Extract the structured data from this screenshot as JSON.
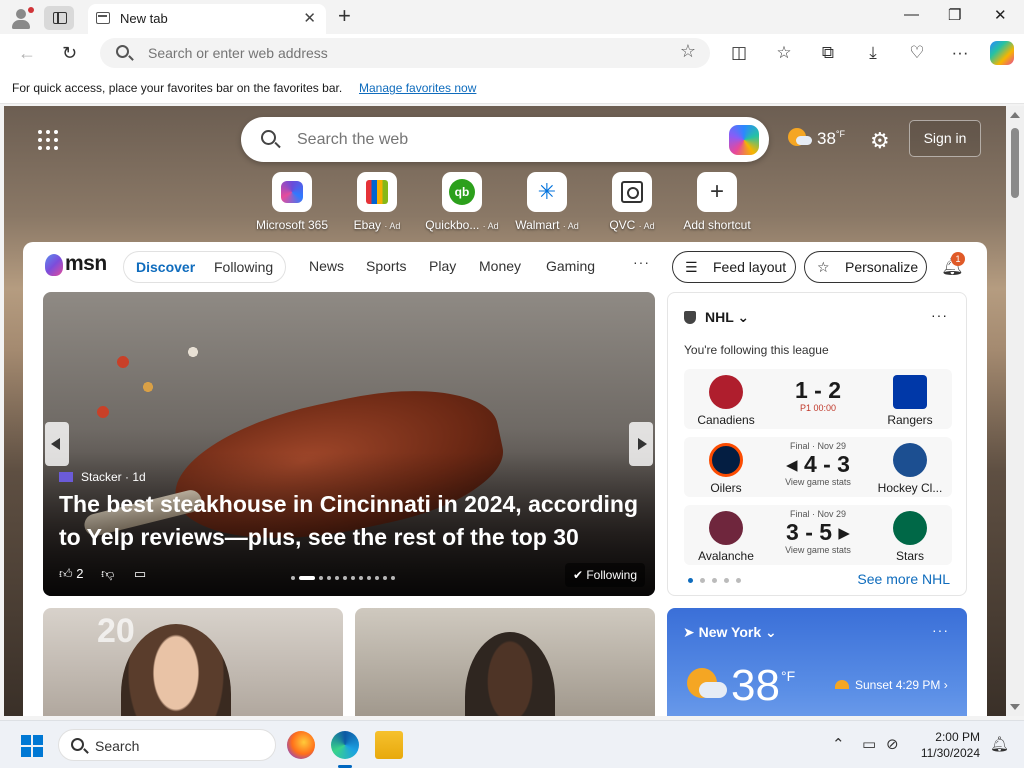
{
  "browser": {
    "tab_title": "New tab",
    "address_placeholder": "Search or enter web address"
  },
  "favbar": {
    "message": "For quick access, place your favorites bar on the favorites bar.",
    "link": "Manage favorites now"
  },
  "newtab": {
    "search_placeholder": "Search the web",
    "weather_temp": "38",
    "weather_unit": "°F",
    "sign_in": "Sign in",
    "shortcuts": [
      {
        "label": "Microsoft 365",
        "ad": ""
      },
      {
        "label": "Ebay",
        "ad": "· Ad"
      },
      {
        "label": "Quickbo...",
        "ad": "· Ad"
      },
      {
        "label": "Walmart",
        "ad": "· Ad"
      },
      {
        "label": "QVC",
        "ad": "· Ad"
      },
      {
        "label": "Add shortcut",
        "ad": ""
      }
    ]
  },
  "feed": {
    "logo": "msn",
    "seg_on": "Discover",
    "seg_off": "Following",
    "nav": [
      "News",
      "Sports",
      "Play",
      "Money",
      "Gaming"
    ],
    "more": "···",
    "feed_layout": "Feed layout",
    "personalize": "Personalize",
    "notif_count": "1"
  },
  "hero": {
    "source": "Stacker · 1d",
    "headline": "The best steakhouse in Cincinnati in 2024, according to Yelp reviews—plus, see the rest of the top 30",
    "likes": "2",
    "following": "Following",
    "slide_index": 1,
    "slide_count": 12
  },
  "nhl": {
    "league": "NHL",
    "subtitle": "You're following this league",
    "games": [
      {
        "home": "Canadiens",
        "away": "Rangers",
        "status": "",
        "score": "1 - 2",
        "period": "P1 00:00",
        "link": "",
        "home_color": "#af1e2d",
        "away_color": "#0038a8"
      },
      {
        "home": "Oilers",
        "away": "Hockey Cl...",
        "status": "Final · Nov 29",
        "score": "◂ 4 - 3",
        "period": "",
        "link": "View game stats",
        "home_color": "#041e42",
        "away_color": "#1c4f91"
      },
      {
        "home": "Avalanche",
        "away": "Stars",
        "status": "Final · Nov 29",
        "score": "3 - 5 ▸",
        "period": "",
        "link": "View game stats",
        "home_color": "#6f263d",
        "away_color": "#006847"
      }
    ],
    "see_more": "See more NHL"
  },
  "weather": {
    "location": "New York",
    "temp": "38",
    "unit": "°F",
    "sunset": "Sunset 4:29 PM"
  },
  "taskbar": {
    "search": "Search",
    "time": "2:00 PM",
    "date": "11/30/2024"
  }
}
